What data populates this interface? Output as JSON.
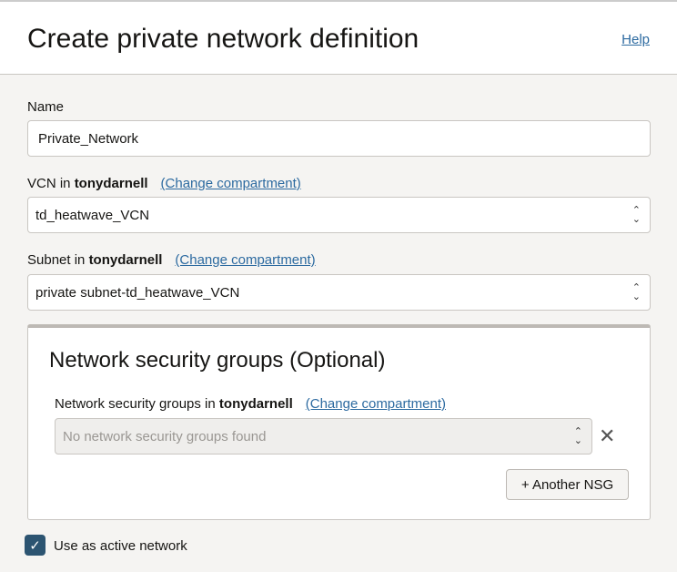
{
  "header": {
    "title": "Create private network definition",
    "help": "Help"
  },
  "name": {
    "label": "Name",
    "value": "Private_Network"
  },
  "vcn": {
    "label_prefix": "VCN in",
    "compartment": "tonydarnell",
    "change": "(Change compartment)",
    "value": "td_heatwave_VCN"
  },
  "subnet": {
    "label_prefix": "Subnet in",
    "compartment": "tonydarnell",
    "change": "(Change compartment)",
    "value": "private subnet-td_heatwave_VCN"
  },
  "nsg": {
    "title": "Network security groups (Optional)",
    "label_prefix": "Network security groups in",
    "compartment": "tonydarnell",
    "change": "(Change compartment)",
    "placeholder": "No network security groups found",
    "add_button": "+ Another NSG"
  },
  "active": {
    "label": "Use as active network",
    "checked": true
  }
}
